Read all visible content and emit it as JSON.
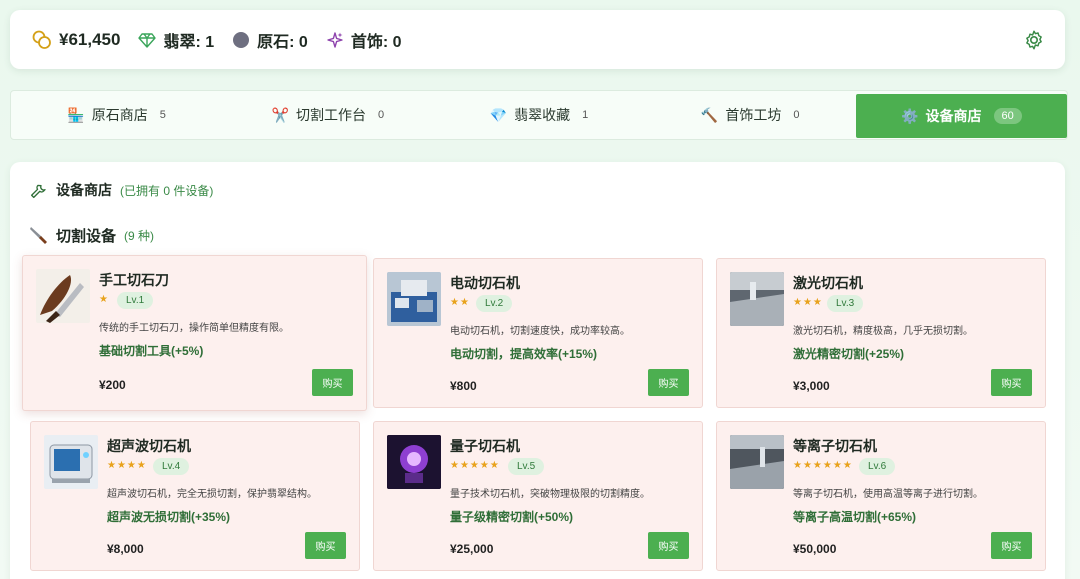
{
  "stats": {
    "money": "¥61,450",
    "jade": "翡翠: 1",
    "raw_stone": "原石: 0",
    "jewelry": "首饰: 0"
  },
  "tabs": [
    {
      "label": "原石商店",
      "count": "5",
      "icon": "shop-icon"
    },
    {
      "label": "切割工作台",
      "count": "0",
      "icon": "scissors-icon"
    },
    {
      "label": "翡翠收藏",
      "count": "1",
      "icon": "gem-icon"
    },
    {
      "label": "首饰工坊",
      "count": "0",
      "icon": "hammer-icon"
    },
    {
      "label": "设备商店",
      "count": "60",
      "icon": "gear-icon"
    }
  ],
  "panel": {
    "title": "设备商店",
    "subtitle": "(已拥有 0 件设备)",
    "section_title": "切割设备",
    "section_count": "(9 种)"
  },
  "cards": [
    {
      "name": "手工切石刀",
      "stars": "★",
      "level": "Lv.1",
      "desc": "传统的手工切石刀，操作简单但精度有限。",
      "effect": "基础切割工具(+5%)",
      "price": "¥200",
      "buy": "购买"
    },
    {
      "name": "电动切石机",
      "stars": "★★",
      "level": "Lv.2",
      "desc": "电动切石机，切割速度快，成功率较高。",
      "effect": "电动切割，提高效率(+15%)",
      "price": "¥800",
      "buy": "购买"
    },
    {
      "name": "激光切石机",
      "stars": "★★★",
      "level": "Lv.3",
      "desc": "激光切石机，精度极高，几乎无损切割。",
      "effect": "激光精密切割(+25%)",
      "price": "¥3,000",
      "buy": "购买"
    },
    {
      "name": "超声波切石机",
      "stars": "★★★★",
      "level": "Lv.4",
      "desc": "超声波切石机，完全无损切割，保护翡翠结构。",
      "effect": "超声波无损切割(+35%)",
      "price": "¥8,000",
      "buy": "购买"
    },
    {
      "name": "量子切石机",
      "stars": "★★★★★",
      "level": "Lv.5",
      "desc": "量子技术切石机，突破物理极限的切割精度。",
      "effect": "量子级精密切割(+50%)",
      "price": "¥25,000",
      "buy": "购买"
    },
    {
      "name": "等离子切石机",
      "stars": "★★★★★★",
      "level": "Lv.6",
      "desc": "等离子切石机，使用高温等离子进行切割。",
      "effect": "等离子高温切割(+65%)",
      "price": "¥50,000",
      "buy": "购买"
    }
  ]
}
